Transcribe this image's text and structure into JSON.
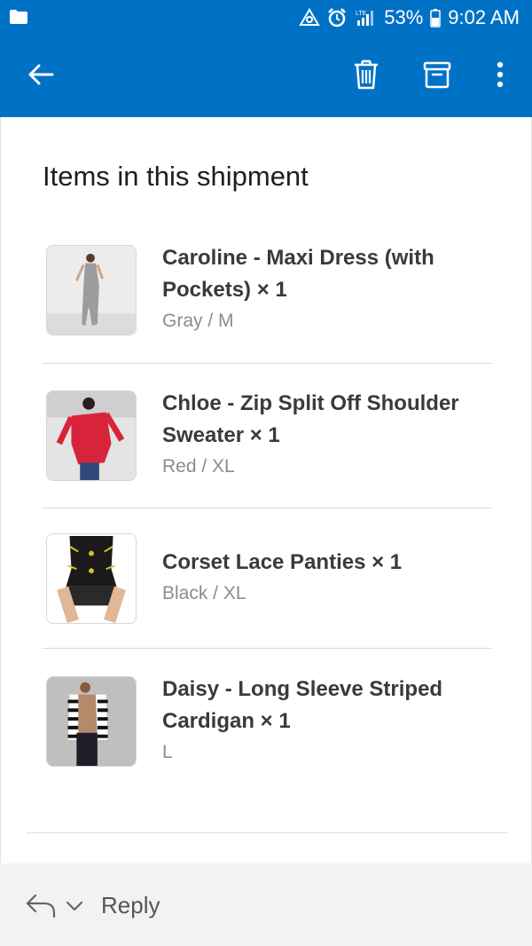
{
  "status_bar": {
    "battery": "53%",
    "time": "9:02 AM",
    "network": "LTE"
  },
  "toolbar": {
    "icons": [
      "back-arrow-icon",
      "trash-icon",
      "archive-icon",
      "more-vertical-icon"
    ]
  },
  "shipment": {
    "title": "Items in this shipment",
    "items": [
      {
        "name": "Caroline - Maxi Dress (with Pockets) × 1",
        "variant": "Gray / M"
      },
      {
        "name": "Chloe - Zip Split Off Shoulder Sweater × 1",
        "variant": "Red / XL"
      },
      {
        "name": "Corset Lace Panties × 1",
        "variant": "Black / XL"
      },
      {
        "name": "Daisy - Long Sleeve Striped Cardigan × 1",
        "variant": "L"
      }
    ]
  },
  "reply": {
    "label": "Reply"
  },
  "colors": {
    "accent": "#0072c6",
    "text_primary": "#3a3a3a",
    "text_secondary": "#8c8c8c"
  }
}
